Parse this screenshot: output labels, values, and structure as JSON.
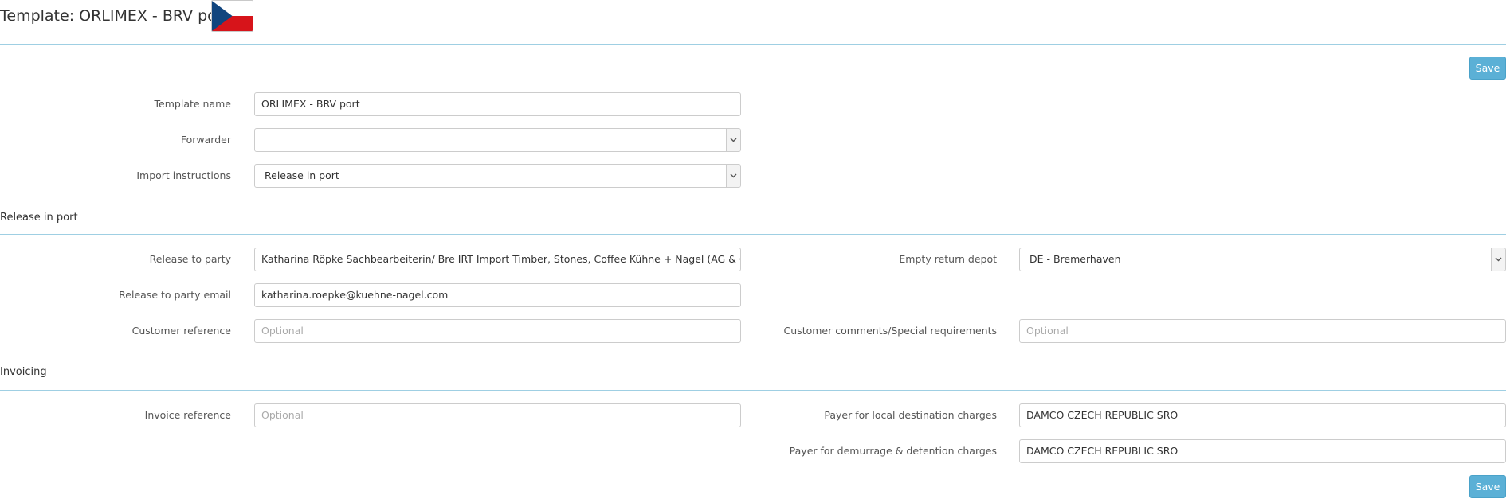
{
  "header": {
    "title": "Template: ORLIMEX - BRV port",
    "flag_icon": "czech-flag-icon",
    "flag_colors": {
      "white": "#ffffff",
      "red": "#d7141a",
      "blue": "#11457e"
    }
  },
  "toolbar": {
    "save_label": "Save"
  },
  "footer": {
    "save_label": "Save"
  },
  "general": {
    "template_name": {
      "label": "Template name",
      "value": "ORLIMEX - BRV port"
    },
    "forwarder": {
      "label": "Forwarder",
      "value": ""
    },
    "import_instructions": {
      "label": "Import instructions",
      "value": "Release in port"
    }
  },
  "release_section": {
    "title": "Release in port",
    "release_to_party": {
      "label": "Release to party",
      "value": "Katharina Röpke Sachbearbeiterin/ Bre IRT  Import Timber, Stones, Coffee  Kühne + Nagel (AG & Co.) KG"
    },
    "release_to_party_email": {
      "label": "Release to party email",
      "value": "katharina.roepke@kuehne-nagel.com"
    },
    "customer_reference": {
      "label": "Customer reference",
      "placeholder": "Optional"
    },
    "empty_return_depot": {
      "label": "Empty return depot",
      "value": "DE - Bremerhaven"
    },
    "customer_comments": {
      "label": "Customer comments/Special requirements",
      "placeholder": "Optional"
    }
  },
  "invoicing_section": {
    "title": "Invoicing",
    "invoice_reference": {
      "label": "Invoice reference",
      "placeholder": "Optional"
    },
    "payer_local": {
      "label": "Payer for local destination charges",
      "value": "DAMCO CZECH REPUBLIC SRO"
    },
    "payer_demurrage": {
      "label": "Payer for demurrage & detention charges",
      "value": "DAMCO CZECH REPUBLIC SRO"
    }
  },
  "colors": {
    "accent": "#5bb0d6",
    "rule": "#9fcfe3"
  }
}
